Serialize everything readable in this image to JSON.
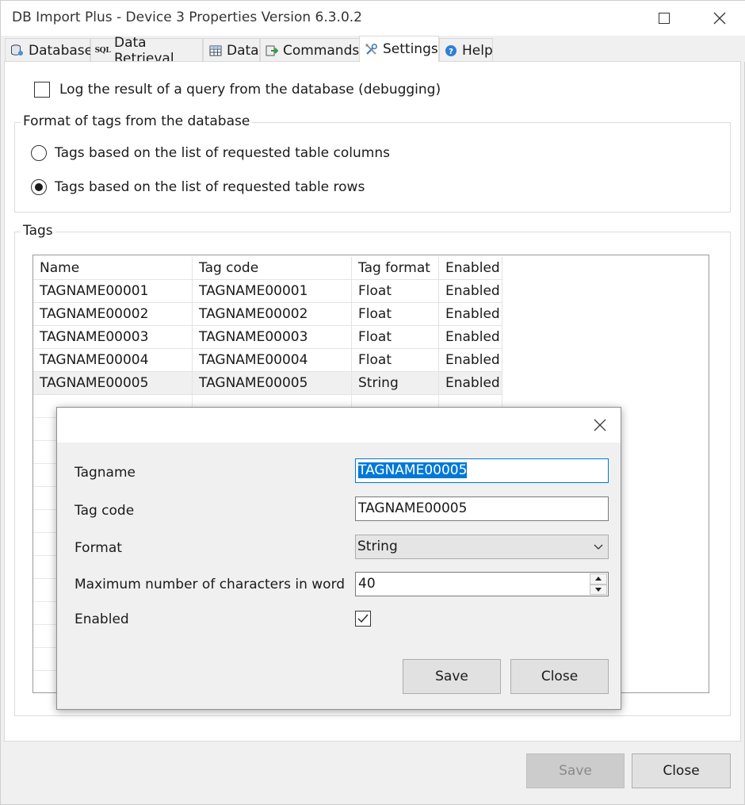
{
  "window": {
    "title": "DB Import Plus - Device 3 Properties Version 6.3.0.2"
  },
  "tabs": [
    {
      "label": "Database",
      "icon": "database-icon"
    },
    {
      "label": "Data Retrieval",
      "icon": "sql-icon",
      "badge": "SQL"
    },
    {
      "label": "Data",
      "icon": "grid-icon"
    },
    {
      "label": "Commands",
      "icon": "commands-icon"
    },
    {
      "label": "Settings",
      "icon": "tools-icon",
      "active": true
    },
    {
      "label": "Help",
      "icon": "help-icon"
    }
  ],
  "settings": {
    "log_checkbox_label": "Log the result of a query from the database (debugging)",
    "log_checked": false,
    "format_group_title": "Format of tags from the database",
    "radio_columns_label": "Tags based on the list of requested table columns",
    "radio_rows_label": "Tags based on the list of requested table rows",
    "selected_format": "rows",
    "tags_group_title": "Tags"
  },
  "tags_table": {
    "headers": [
      "Name",
      "Tag code",
      "Tag format",
      "Enabled"
    ],
    "rows": [
      [
        "TAGNAME00001",
        "TAGNAME00001",
        "Float",
        "Enabled"
      ],
      [
        "TAGNAME00002",
        "TAGNAME00002",
        "Float",
        "Enabled"
      ],
      [
        "TAGNAME00003",
        "TAGNAME00003",
        "Float",
        "Enabled"
      ],
      [
        "TAGNAME00004",
        "TAGNAME00004",
        "Float",
        "Enabled"
      ],
      [
        "TAGNAME00005",
        "TAGNAME00005",
        "String",
        "Enabled"
      ]
    ],
    "selected_row": 4
  },
  "footer": {
    "save_label": "Save",
    "close_label": "Close"
  },
  "dialog": {
    "tagname_label": "Tagname",
    "tagname_value": "TAGNAME00005",
    "tagcode_label": "Tag code",
    "tagcode_value": "TAGNAME00005",
    "format_label": "Format",
    "format_value": "String",
    "maxchars_label": "Maximum number of characters in word",
    "maxchars_value": "40",
    "enabled_label": "Enabled",
    "enabled_checked": true,
    "save_label": "Save",
    "close_label": "Close"
  }
}
